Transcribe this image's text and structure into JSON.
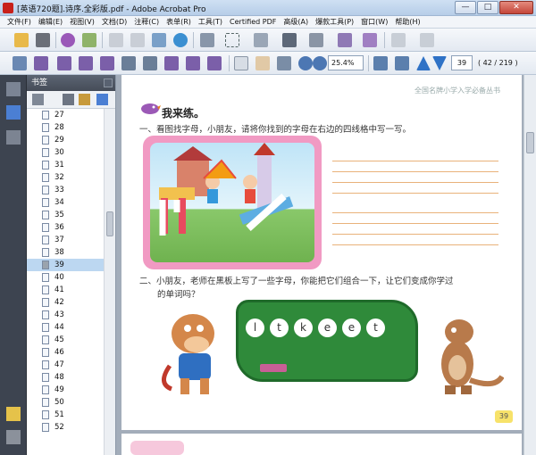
{
  "window": {
    "title": "[英语720题].诗序.全彩版.pdf - Adobe Acrobat Pro",
    "buttons": [
      "—",
      "□",
      "✕"
    ]
  },
  "menu": [
    "文件(F)",
    "编辑(E)",
    "视图(V)",
    "文档(D)",
    "注释(C)",
    "表单(R)",
    "工具(T)",
    "Certified PDF",
    "高级(A)",
    "爆款工具(P)",
    "窗口(W)",
    "帮助(H)"
  ],
  "toolbar": {
    "zoom_value": "25.4%",
    "page_value": "39",
    "page_count": "( 42 / 219 )"
  },
  "bookmarks": {
    "title": "书签",
    "items": [
      "27",
      "28",
      "29",
      "30",
      "31",
      "32",
      "33",
      "34",
      "35",
      "36",
      "37",
      "38",
      "39",
      "40",
      "41",
      "42",
      "43",
      "44",
      "45",
      "46",
      "47",
      "48",
      "49",
      "50",
      "51",
      "52"
    ],
    "selected": "39"
  },
  "page": {
    "header": "全国名牌小学入学必备丛书",
    "section_title": "我来练。",
    "q1": "一、看图找字母，小朋友，请将你找到的字母在右边的四线格中写一写。",
    "q2_line1": "二、小朋友，老师在黑板上写了一些字母，你能把它们组合一下，让它们变成你学过",
    "q2_line2": "的单词吗？",
    "letters": [
      "l",
      "t",
      "k",
      "e",
      "e",
      "t"
    ],
    "page_number": "39"
  },
  "colors": {
    "frame_pink": "#f19ac3",
    "board_green": "#2f8a3a",
    "line_orange": "#e9b27a",
    "selection_blue": "#bcd7f1"
  }
}
